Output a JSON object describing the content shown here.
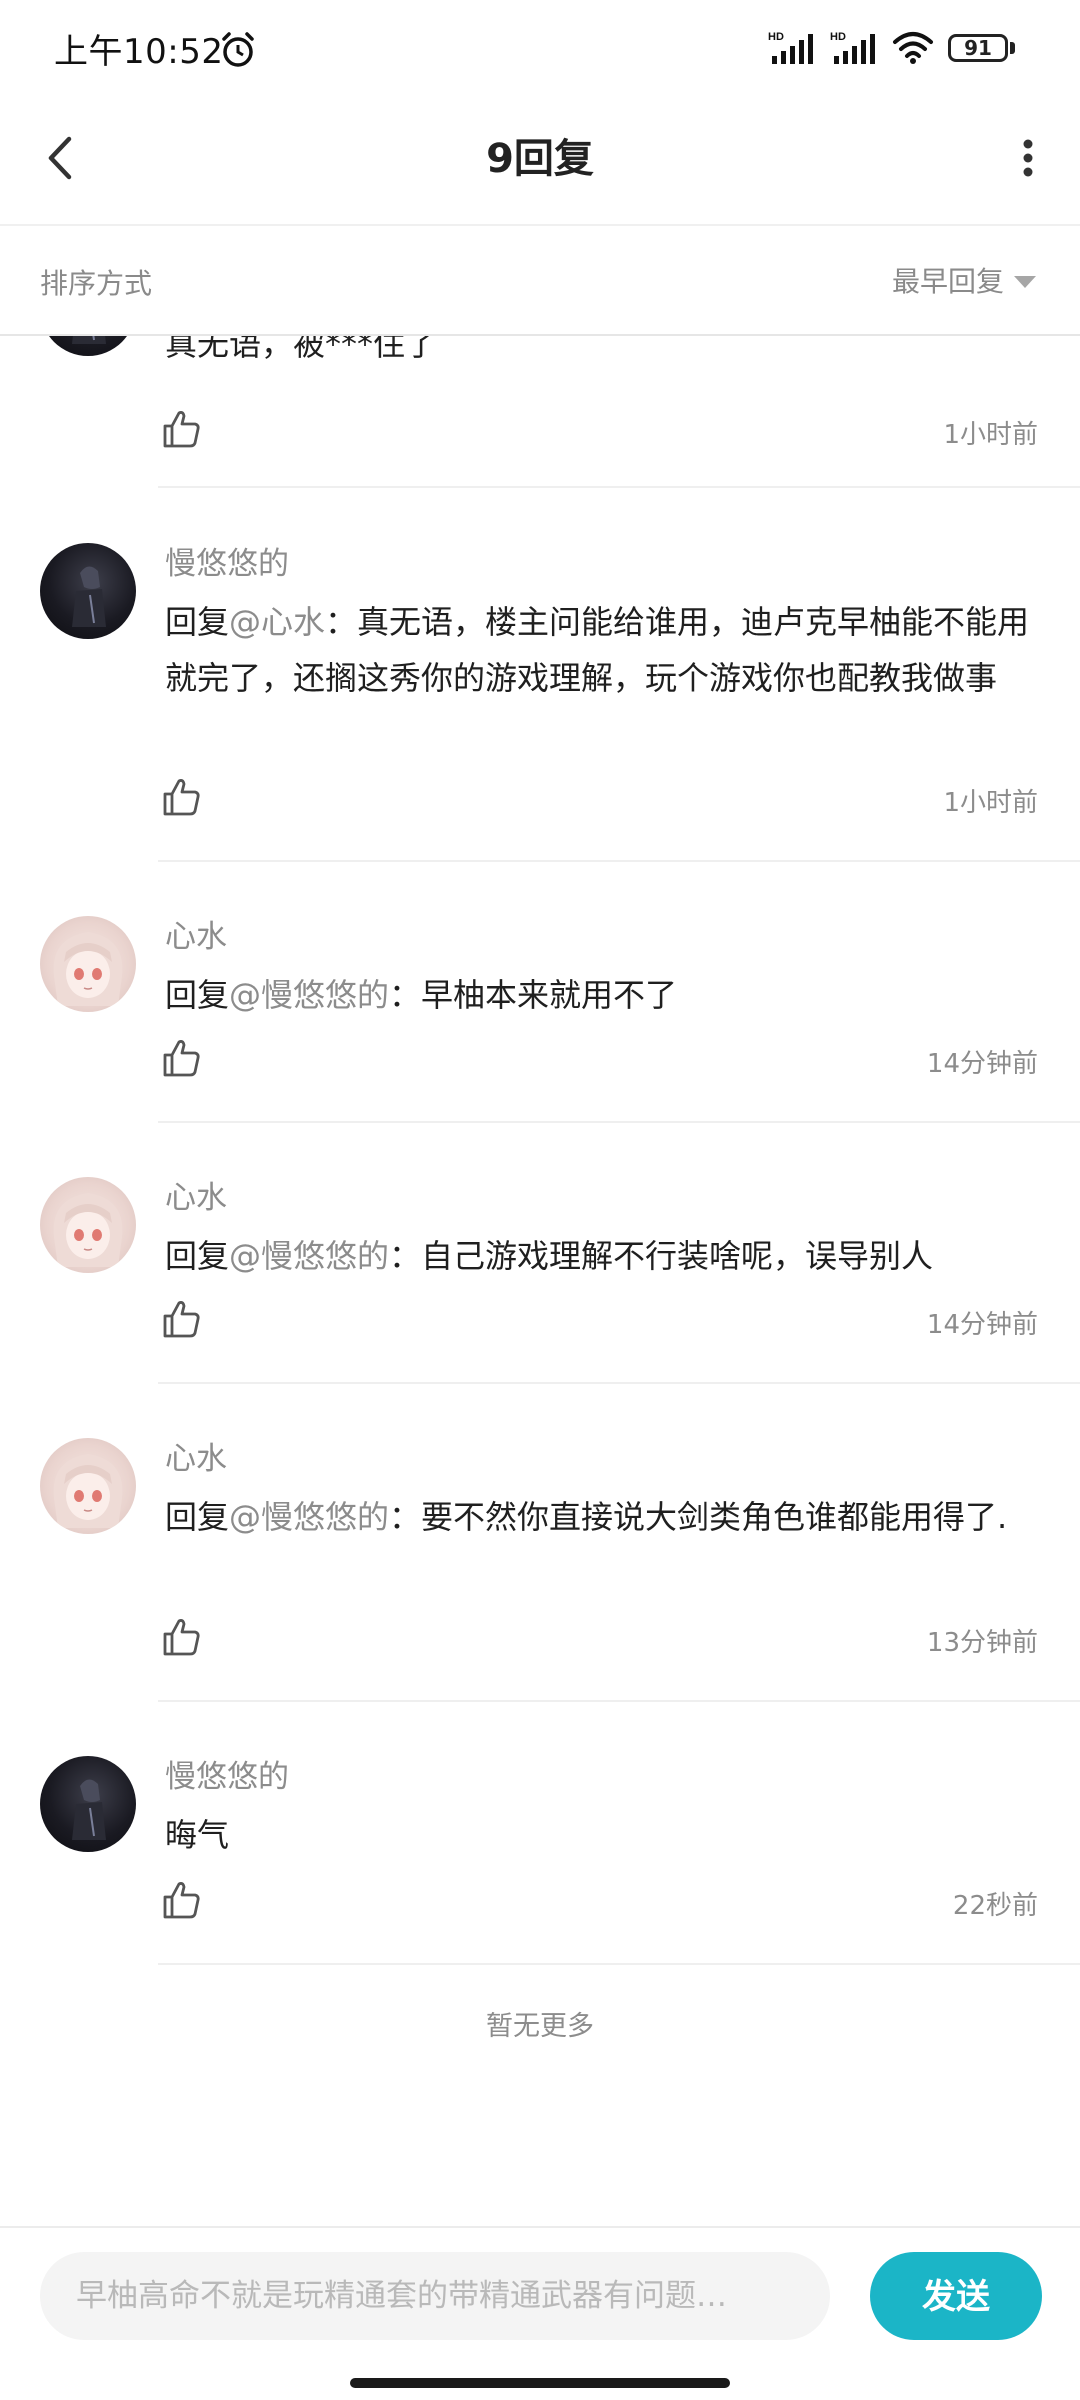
{
  "status_bar": {
    "time": "上午10:52",
    "battery": "91"
  },
  "header": {
    "title": "9回复"
  },
  "sort": {
    "label": "排序方式",
    "value": "最早回复"
  },
  "comments": [
    {
      "avatar": "dark-character-avatar",
      "name": "",
      "reply_prefix": "",
      "mention": "",
      "text": "真无语，被***住了",
      "time": "1小时前"
    },
    {
      "avatar": "dark-character-avatar",
      "name": "慢悠悠的",
      "reply_prefix": "回复",
      "mention": "@心水",
      "text": "：真无语，楼主问能给谁用，迪卢克早柚能不能用就完了，还搁这秀你的游戏理解，玩个游戏你也配教我做事",
      "time": "1小时前"
    },
    {
      "avatar": "anime-girl-avatar",
      "name": "心水",
      "reply_prefix": "回复",
      "mention": "@慢悠悠的",
      "text": "：早柚本来就用不了",
      "time": "14分钟前"
    },
    {
      "avatar": "anime-girl-avatar",
      "name": "心水",
      "reply_prefix": "回复",
      "mention": "@慢悠悠的",
      "text": "：自己游戏理解不行装啥呢，误导别人",
      "time": "14分钟前"
    },
    {
      "avatar": "anime-girl-avatar",
      "name": "心水",
      "reply_prefix": "回复",
      "mention": "@慢悠悠的",
      "text": "：要不然你直接说大剑类角色谁都能用得了.",
      "time": "13分钟前"
    },
    {
      "avatar": "dark-character-avatar",
      "name": "慢悠悠的",
      "reply_prefix": "",
      "mention": "",
      "text": "晦气",
      "time": "22秒前"
    }
  ],
  "footer_note": "暂无更多",
  "input": {
    "placeholder": "早柚高命不就是玩精通套的带精通武器有问题…",
    "send_label": "发送"
  },
  "colors": {
    "accent": "#1bb5c7",
    "secondary_text": "#8c8c8c",
    "primary_text": "#1f1f1f"
  }
}
